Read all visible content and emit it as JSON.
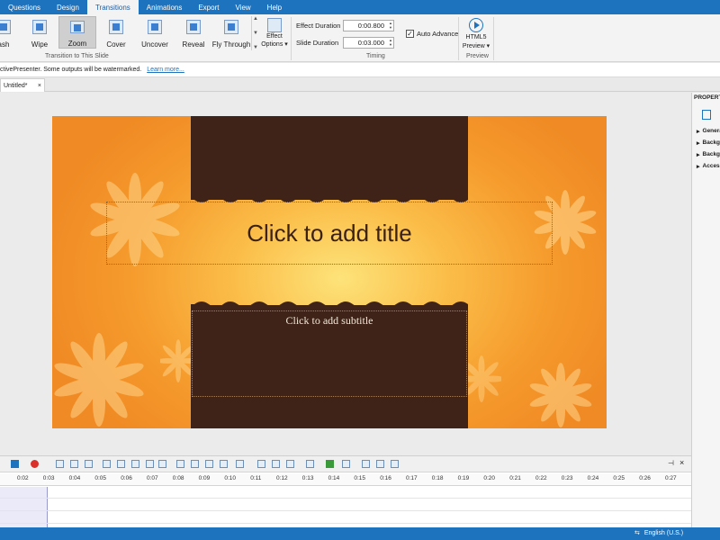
{
  "ribbon_tabs": [
    {
      "label": "Questions"
    },
    {
      "label": "Design"
    },
    {
      "label": "Transitions"
    },
    {
      "label": "Animations"
    },
    {
      "label": "Export"
    },
    {
      "label": "View"
    },
    {
      "label": "Help"
    }
  ],
  "active_tab": "Transitions",
  "transitions": [
    {
      "label": "ash"
    },
    {
      "label": "Wipe"
    },
    {
      "label": "Zoom"
    },
    {
      "label": "Cover"
    },
    {
      "label": "Uncover"
    },
    {
      "label": "Reveal"
    },
    {
      "label": "Fly Through"
    }
  ],
  "selected_transition": "Zoom",
  "effect_options": {
    "line1": "Effect",
    "line2": "Options ▾"
  },
  "group_transition_label": "Transition to This Slide",
  "timing": {
    "effect_duration_label": "Effect Duration",
    "effect_duration_value": "0:00.800",
    "slide_duration_label": "Slide Duration",
    "slide_duration_value": "0:03.000",
    "auto_advance_label": "Auto Advance",
    "auto_advance_checked": true,
    "group_label": "Timing"
  },
  "preview": {
    "line1": "HTML5",
    "line2": "Preview ▾",
    "group_label": "Preview"
  },
  "infobar": {
    "message": "ctivePresenter. Some outputs will be watermarked.",
    "link": "Learn more..."
  },
  "document_tab": {
    "title": "Untitled*",
    "close": "×"
  },
  "slide": {
    "title_placeholder": "Click to add title",
    "subtitle_placeholder": "Click to add subtitle"
  },
  "properties": {
    "header": "PROPERTI",
    "items": [
      {
        "label": "Genera"
      },
      {
        "label": "Backgr"
      },
      {
        "label": "Backgr"
      },
      {
        "label": "Access"
      }
    ]
  },
  "timeline": {
    "ticks": [
      "0:02",
      "0:03",
      "0:04",
      "0:05",
      "0:06",
      "0:07",
      "0:08",
      "0:09",
      "0:10",
      "0:11",
      "0:12",
      "0:13",
      "0:14",
      "0:15",
      "0:16",
      "0:17",
      "0:18",
      "0:19",
      "0:20",
      "0:21",
      "0:22",
      "0:23",
      "0:24",
      "0:25",
      "0:26",
      "0:27"
    ]
  },
  "status": {
    "language": "English (U.S.)"
  },
  "colors": {
    "accent": "#1e73be",
    "slide_brown": "#3f2318",
    "slide_orange": "#f59a2c"
  }
}
